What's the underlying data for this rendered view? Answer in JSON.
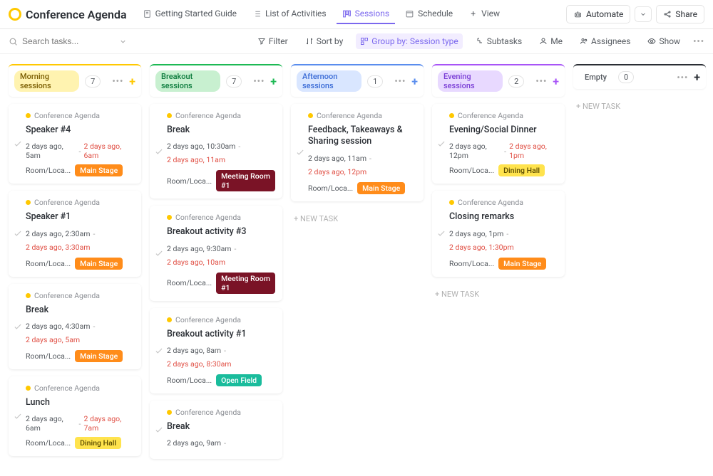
{
  "header": {
    "title": "Conference Agenda",
    "tabs": [
      {
        "label": "Getting Started Guide",
        "active": false
      },
      {
        "label": "List of Activities",
        "active": false
      },
      {
        "label": "Sessions",
        "active": true
      },
      {
        "label": "Schedule",
        "active": false
      },
      {
        "label": "View",
        "active": false
      }
    ],
    "automate": "Automate",
    "share": "Share"
  },
  "toolbar": {
    "search_placeholder": "Search tasks...",
    "filter": "Filter",
    "sort": "Sort by",
    "group": "Group by: Session type",
    "subtasks": "Subtasks",
    "me": "Me",
    "assignees": "Assignees",
    "show": "Show"
  },
  "new_task_label": "+ NEW TASK",
  "columns": [
    {
      "label": "Morning sessions",
      "count": "7",
      "pill_bg": "#fff3b0",
      "pill_fg": "#7a5c00",
      "border": "#ffc800",
      "plus": "#ffc800",
      "cards": [
        {
          "proj": "Conference Agenda",
          "title": "Speaker #4",
          "start": "2 days ago, 5am",
          "due": "2 days ago, 6am",
          "inline_due": true,
          "loc": "Room/Loca...",
          "tag": "Main Stage",
          "tag_bg": "#ff8c1a",
          "tag_fg": "#fff"
        },
        {
          "proj": "Conference Agenda",
          "title": "Speaker #1",
          "start": "2 days ago, 2:30am",
          "due": "2 days ago, 3:30am",
          "loc": "Room/Loca...",
          "tag": "Main Stage",
          "tag_bg": "#ff8c1a",
          "tag_fg": "#fff"
        },
        {
          "proj": "Conference Agenda",
          "title": "Break",
          "start": "2 days ago, 4:30am",
          "due": "2 days ago, 5am",
          "loc": "Room/Loca...",
          "tag": "Main Stage",
          "tag_bg": "#ff8c1a",
          "tag_fg": "#fff"
        },
        {
          "proj": "Conference Agenda",
          "title": "Lunch",
          "start": "2 days ago, 6am",
          "due": "2 days ago, 7am",
          "inline_due": true,
          "loc": "Room/Loca...",
          "tag": "Dining Hall",
          "tag_bg": "#ffe34d",
          "tag_fg": "#5a4a00"
        }
      ]
    },
    {
      "label": "Breakout sessions",
      "count": "7",
      "pill_bg": "#c8f0d0",
      "pill_fg": "#0a7a3b",
      "border": "#1db954",
      "plus": "#1db954",
      "cards": [
        {
          "proj": "Conference Agenda",
          "title": "Break",
          "start": "2 days ago, 10:30am",
          "due": "2 days ago, 11am",
          "loc": "Room/Loca...",
          "tag": "Meeting Room #1",
          "tag_bg": "#7a1326",
          "tag_fg": "#fff"
        },
        {
          "proj": "Conference Agenda",
          "title": "Breakout activity #3",
          "start": "2 days ago, 9:30am",
          "due": "2 days ago, 10am",
          "loc": "Room/Loca...",
          "tag": "Meeting Room #1",
          "tag_bg": "#7a1326",
          "tag_fg": "#fff"
        },
        {
          "proj": "Conference Agenda",
          "title": "Breakout activity #1",
          "start": "2 days ago, 8am",
          "due": "2 days ago, 8:30am",
          "loc": "Room/Loca...",
          "tag": "Open Field",
          "tag_bg": "#1abc9c",
          "tag_fg": "#fff"
        },
        {
          "proj": "Conference Agenda",
          "title": "Break",
          "start": "2 days ago, 9am",
          "no_due": true
        }
      ]
    },
    {
      "label": "Afternoon sessions",
      "count": "1",
      "pill_bg": "#d9e6ff",
      "pill_fg": "#3a6bd6",
      "border": "#5a8dee",
      "plus": "#5a8dee",
      "cards": [
        {
          "proj": "Conference Agenda",
          "title": "Feedback, Takeaways & Sharing session",
          "start": "2 days ago, 11am",
          "due": "2 days ago, 12pm",
          "loc": "Room/Loca...",
          "tag": "Main Stage",
          "tag_bg": "#ff8c1a",
          "tag_fg": "#fff"
        }
      ],
      "show_new": true
    },
    {
      "label": "Evening sessions",
      "count": "2",
      "pill_bg": "#e8d9ff",
      "pill_fg": "#7b3fd6",
      "border": "#a855f7",
      "plus": "#a855f7",
      "cards": [
        {
          "proj": "Conference Agenda",
          "title": "Evening/Social Dinner",
          "start": "2 days ago, 12pm",
          "due": "2 days ago, 1pm",
          "inline_due": true,
          "loc": "Room/Loca...",
          "tag": "Dining Hall",
          "tag_bg": "#ffe34d",
          "tag_fg": "#5a4a00"
        },
        {
          "proj": "Conference Agenda",
          "title": "Closing remarks",
          "start": "2 days ago, 1pm",
          "due": "2 days ago, 1:30pm",
          "loc": "Room/Loca...",
          "tag": "Main Stage",
          "tag_bg": "#ff8c1a",
          "tag_fg": "#fff"
        }
      ],
      "show_new": true
    },
    {
      "label": "Empty",
      "count": "0",
      "pill_bg": "transparent",
      "pill_fg": "#54595f",
      "border": "#2a2e34",
      "plus": "#2a2e34",
      "cards": [],
      "show_new": true
    }
  ]
}
